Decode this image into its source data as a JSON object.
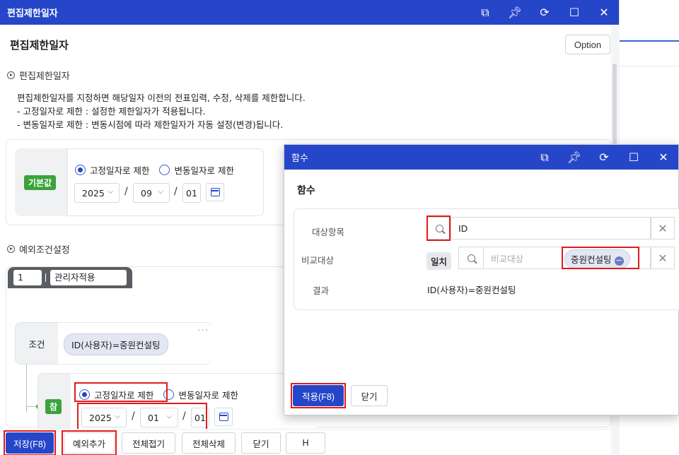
{
  "main_window": {
    "title": "편집제한일자",
    "page_title": "편집제한일자",
    "option_label": "Option",
    "icons": [
      "popout-icon",
      "pin-icon",
      "refresh-icon",
      "maximize-icon",
      "close-icon"
    ]
  },
  "section_limit": {
    "heading": "편집제한일자",
    "desc_lines": [
      "편집제한일자를 지정하면 해당일자 이전의 전표입력, 수정, 삭제를 제한합니다.",
      "- 고정일자로 제한 : 설정한 제한일자가 적용됩니다.",
      "- 변동일자로 제한 : 변동시점에 따라 제한일자가 자동 설정(변경)됩니다."
    ],
    "default_badge": "기본값",
    "radio_fixed": "고정일자로 제한",
    "radio_variable": "변동일자로 제한",
    "selected": "fixed",
    "year": "2025",
    "month": "09",
    "day": "01"
  },
  "section_exception": {
    "heading": "예외조건설정",
    "index": "1",
    "name": "관리자적용",
    "condition_label": "조건",
    "condition_chip": "ID(사용자)=중원컨설팅",
    "more": "···",
    "true_badge": "참",
    "radio_fixed": "고정일자로 제한",
    "radio_variable": "변동일자로 제한",
    "selected": "fixed",
    "year": "2025",
    "month": "01",
    "day": "01"
  },
  "bottom_buttons": {
    "save": "저장(F8)",
    "add_exception": "예외추가",
    "collapse_all": "전체접기",
    "delete_all": "전체삭제",
    "close": "닫기",
    "h": "H"
  },
  "function_dialog": {
    "title": "함수",
    "heading": "함수",
    "target_label": "대상항목",
    "target_value": "ID",
    "compare_label": "비교대상",
    "match_tag": "일치",
    "compare_placeholder": "비교대상",
    "compare_chip": "중원컨설팅",
    "result_label": "결과",
    "result_value": "ID(사용자)=중원컨설팅",
    "apply": "적용(F8)",
    "close": "닫기"
  },
  "colors": {
    "titlebar": "#2546c8",
    "primary": "#2546c8",
    "green_badge": "#3aa33a",
    "highlight_red": "#e01b1b"
  }
}
